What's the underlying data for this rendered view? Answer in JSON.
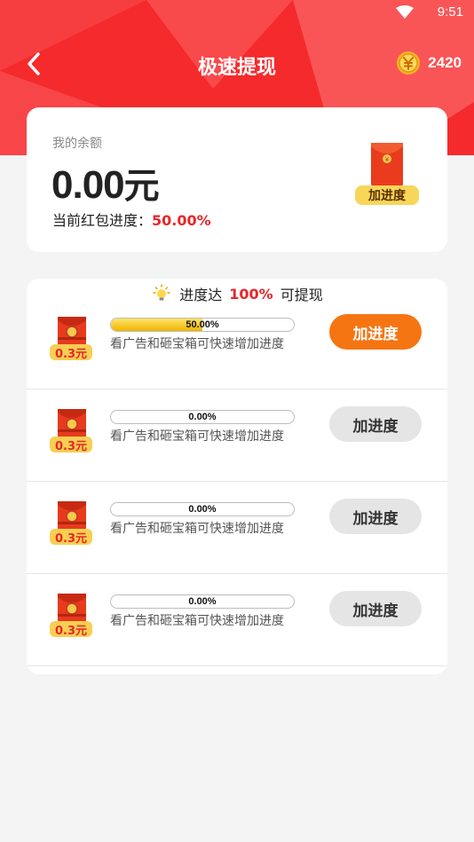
{
  "status": {
    "time": "9:51"
  },
  "header": {
    "title": "极速提现",
    "coins": "2420"
  },
  "balance": {
    "label": "我的余额",
    "amount": "0.00",
    "unit": "元",
    "progress_prefix": "当前红包进度：",
    "progress_value": "50.00%",
    "envelope_badge": "加进度"
  },
  "tasks": {
    "header_prefix": "进度达",
    "header_highlight": "100%",
    "header_suffix": "可提现",
    "rows": [
      {
        "reward": "0.3元",
        "progress": 0.5,
        "progress_label": "50.00%",
        "desc": "看广告和砸宝箱可快速增加进度",
        "button": "加进度",
        "active": true
      },
      {
        "reward": "0.3元",
        "progress": 0.0,
        "progress_label": "0.00%",
        "desc": "看广告和砸宝箱可快速增加进度",
        "button": "加进度",
        "active": false
      },
      {
        "reward": "0.3元",
        "progress": 0.0,
        "progress_label": "0.00%",
        "desc": "看广告和砸宝箱可快速增加进度",
        "button": "加进度",
        "active": false
      },
      {
        "reward": "0.3元",
        "progress": 0.0,
        "progress_label": "0.00%",
        "desc": "看广告和砸宝箱可快速增加进度",
        "button": "加进度",
        "active": false
      }
    ]
  },
  "colors": {
    "header_red": "#f52a2c",
    "accent_red": "#e8262a",
    "button_orange": "#f57512",
    "badge_yellow": "#f7d65a"
  }
}
